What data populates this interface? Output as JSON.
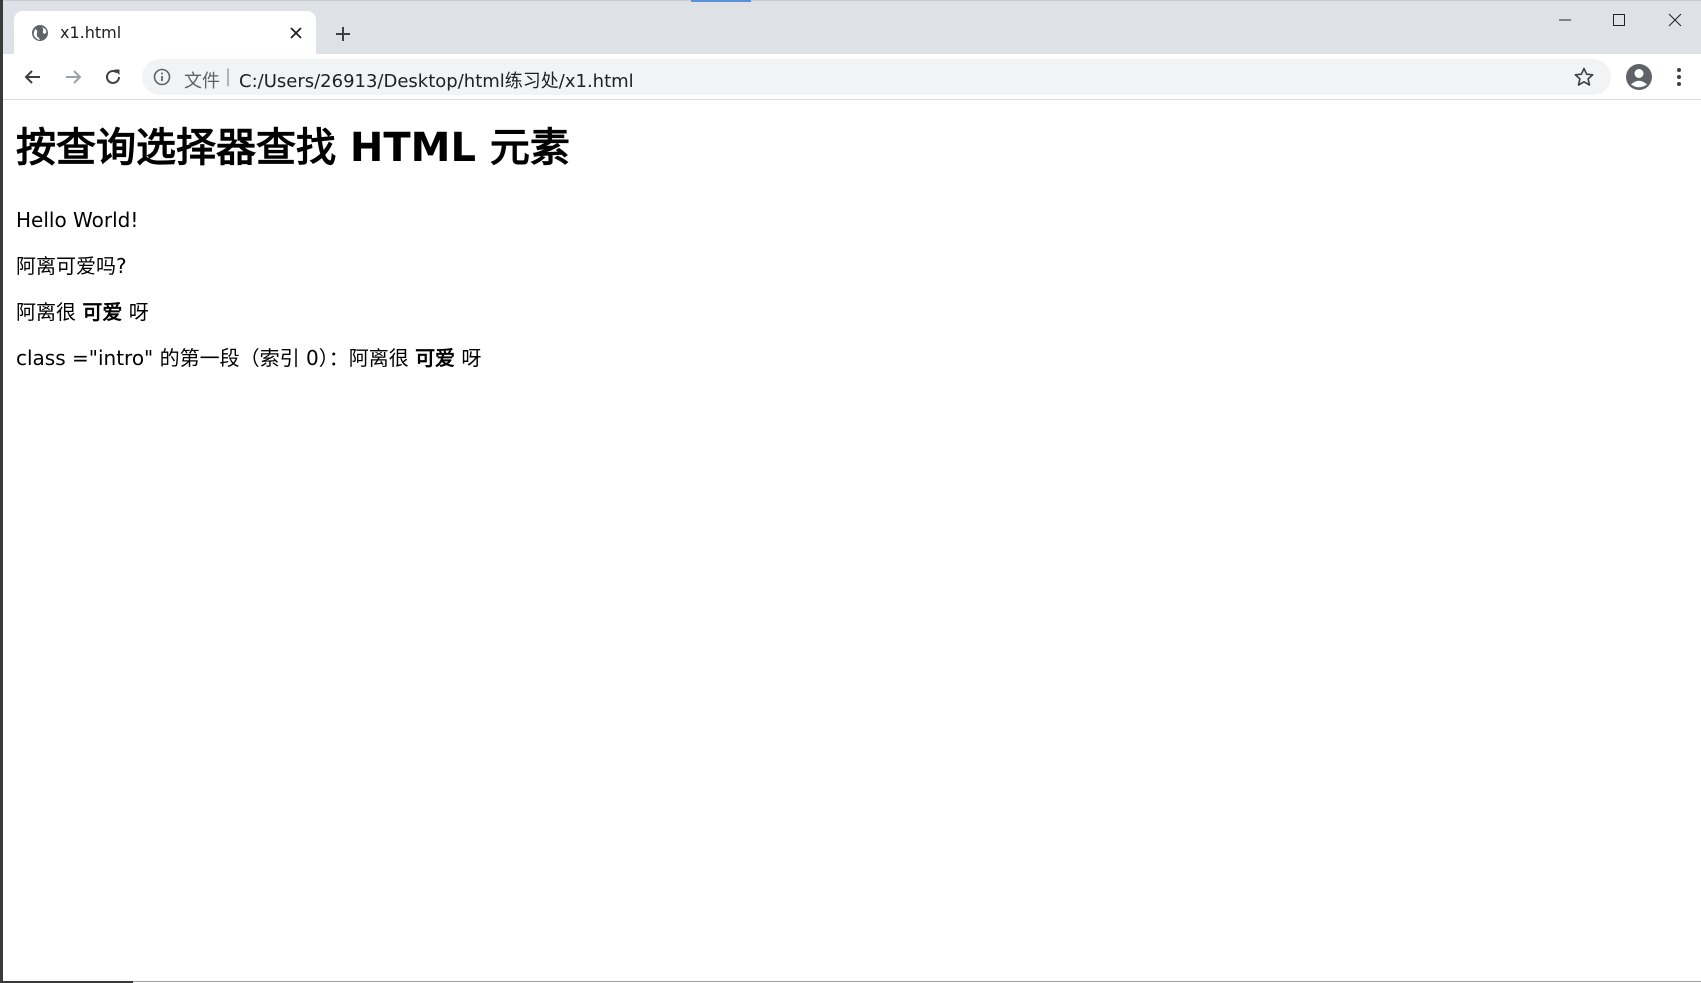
{
  "browser": {
    "tab": {
      "title": "x1.html",
      "favicon": "globe-icon"
    },
    "new_tab_icon": "plus-icon",
    "window_controls": [
      "minimize-icon",
      "maximize-icon",
      "close-icon"
    ],
    "toolbar": {
      "back_icon": "arrow-left-icon",
      "forward_icon": "arrow-right-icon",
      "reload_icon": "reload-icon",
      "scheme_label": "文件",
      "separator": "|",
      "url": "C:/Users/26913/Desktop/html练习处/x1.html",
      "bookmark_icon": "star-icon",
      "profile_icon": "account-icon",
      "menu_icon": "more-vert-icon"
    },
    "colors": {
      "tabstrip_bg": "#dee1e6",
      "omnibox_bg": "#f1f3f4",
      "icon_color": "#5f6368"
    }
  },
  "page": {
    "heading": "按查询选择器查找 HTML 元素",
    "p1": "Hello World!",
    "p2": "阿离可爱吗?",
    "p3": {
      "before": "阿离很 ",
      "bold": "可爱",
      "after": " 呀"
    },
    "p4": {
      "before": "class =\"intro\" 的第一段（索引 0）：阿离很 ",
      "bold": "可爱",
      "after": " 呀"
    }
  }
}
